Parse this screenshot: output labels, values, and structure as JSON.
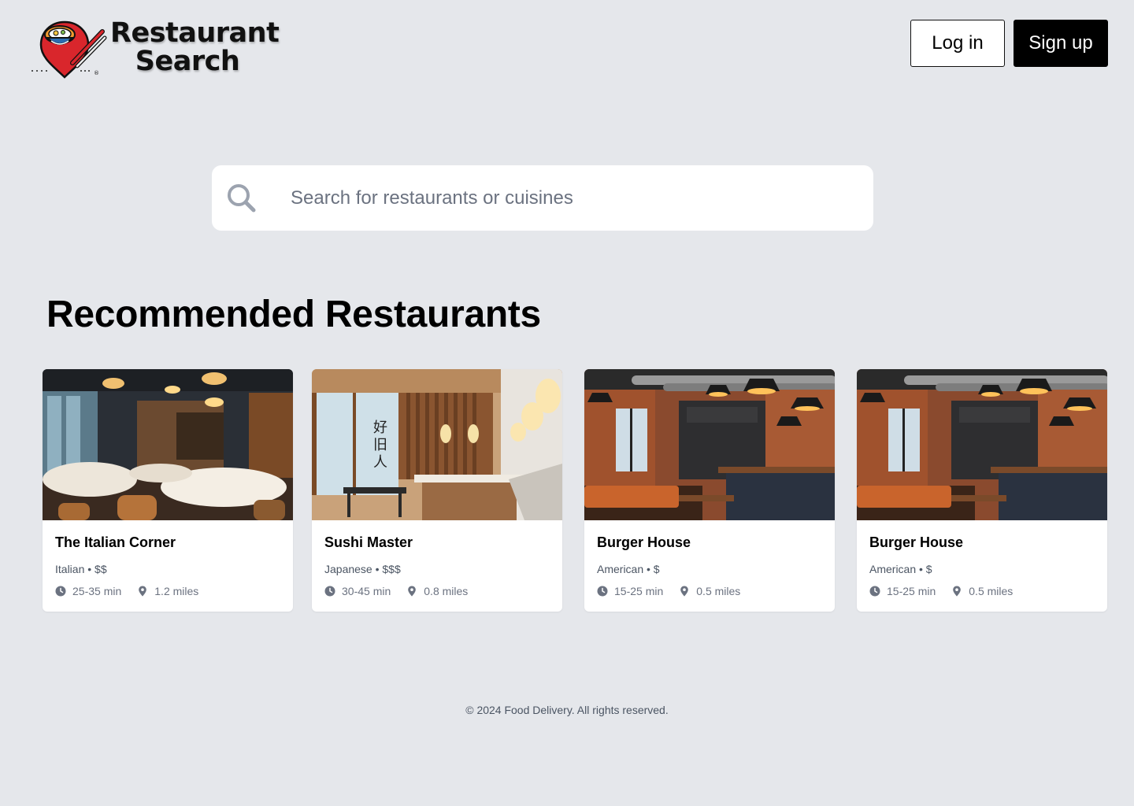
{
  "brand": {
    "line1": "Restaurant",
    "line2": "Search",
    "logo_icon": "bowl-chopsticks-pin-icon",
    "registered_mark": "®"
  },
  "header": {
    "login_label": "Log in",
    "signup_label": "Sign up"
  },
  "search": {
    "placeholder": "Search for restaurants or cuisines",
    "value": "",
    "icon": "search-icon"
  },
  "section": {
    "title": "Recommended Restaurants"
  },
  "restaurants": [
    {
      "name": "The Italian Corner",
      "meta": "Italian • $$",
      "time": "25-35 min",
      "distance": "1.2 miles",
      "image": "dining-room-photo"
    },
    {
      "name": "Sushi Master",
      "meta": "Japanese • $$$",
      "time": "30-45 min",
      "distance": "0.8 miles",
      "image": "sushi-bar-photo"
    },
    {
      "name": "Burger House",
      "meta": "American • $",
      "time": "15-25 min",
      "distance": "0.5 miles",
      "image": "brick-diner-photo"
    },
    {
      "name": "Burger House",
      "meta": "American • $",
      "time": "15-25 min",
      "distance": "0.5 miles",
      "image": "brick-diner-photo"
    }
  ],
  "footer": {
    "text": "© 2024 Food Delivery. All rights reserved."
  },
  "colors": {
    "background": "#e5e7eb",
    "primary": "#000000",
    "logo_red": "#d9262c",
    "logo_orange": "#f29a2e"
  }
}
